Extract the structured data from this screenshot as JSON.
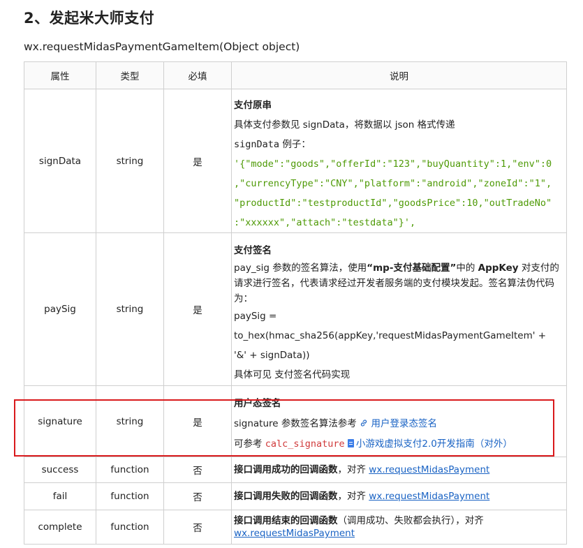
{
  "heading": "2、发起米大师支付",
  "function_signature": "wx.requestMidasPaymentGameItem(Object  object)",
  "headers": {
    "attr": "属性",
    "type": "类型",
    "required": "必填",
    "desc": "说明"
  },
  "rows": {
    "signData": {
      "name": "signData",
      "type": "string",
      "required": "是",
      "title": "支付原串",
      "text1": "具体支付参数见 signData，将数据以 json 格式传递",
      "example_code": "signData",
      "example_label": " 例子：",
      "code_lines": [
        "'{\"mode\":\"goods\",\"offerId\":\"123\",\"buyQuantity\":1,\"env\":0",
        ",\"currencyType\":\"CNY\",\"platform\":\"android\",\"zoneId\":\"1\",",
        "\"productId\":\"testproductId\",\"goodsPrice\":10,\"outTradeNo\"",
        ":\"xxxxxx\",\"attach\":\"testdata\"}',"
      ]
    },
    "paySig": {
      "name": "paySig",
      "type": "string",
      "required": "是",
      "title": "支付签名",
      "text_pre": "pay_sig 参数的签名算法，使用",
      "text_bold1": "“mp-支付基础配置”",
      "text_mid": "中的 ",
      "text_bold2": "AppKey",
      "text_post": " 对支付的请求进行签名，代表请求经过开发者服务端的支付模块发起。签名算法伪代码为：",
      "code1": "paySig  =",
      "code2": "to_hex(hmac_sha256(appKey,'requestMidasPaymentGameItem'  +",
      "code3": "'&'  +  signData))",
      "note": "具体可见  支付签名代码实现"
    },
    "signature": {
      "name": "signature",
      "type": "string",
      "required": "是",
      "title": "用户态签名",
      "text1": "signature 参数签名算法参考 ",
      "link1": "用户登录态签名",
      "text2": "可参考 ",
      "code": "calc_signature",
      "link2": "小游戏虚拟支付2.0开发指南（对外）"
    },
    "success": {
      "name": "success",
      "type": "function",
      "required": "否",
      "bold": "接口调用成功的回调函数",
      "mid": "，对齐 ",
      "link": "wx.requestMidasPayment"
    },
    "fail": {
      "name": "fail",
      "type": "function",
      "required": "否",
      "bold": "接口调用失败的回调函数",
      "mid": "，对齐 ",
      "link": "wx.requestMidasPayment"
    },
    "complete": {
      "name": "complete",
      "type": "function",
      "required": "否",
      "bold": "接口调用结束的回调函数",
      "mid": "（调用成功、失败都会执行），对齐 ",
      "link": "wx.requestMidasPayment"
    }
  },
  "colors": {
    "accent_link": "#1a63c4",
    "code_green": "#4e9a06",
    "code_red": "#d0393a",
    "highlight": "#d9191c"
  },
  "icons": [
    "link-icon",
    "document-icon"
  ]
}
